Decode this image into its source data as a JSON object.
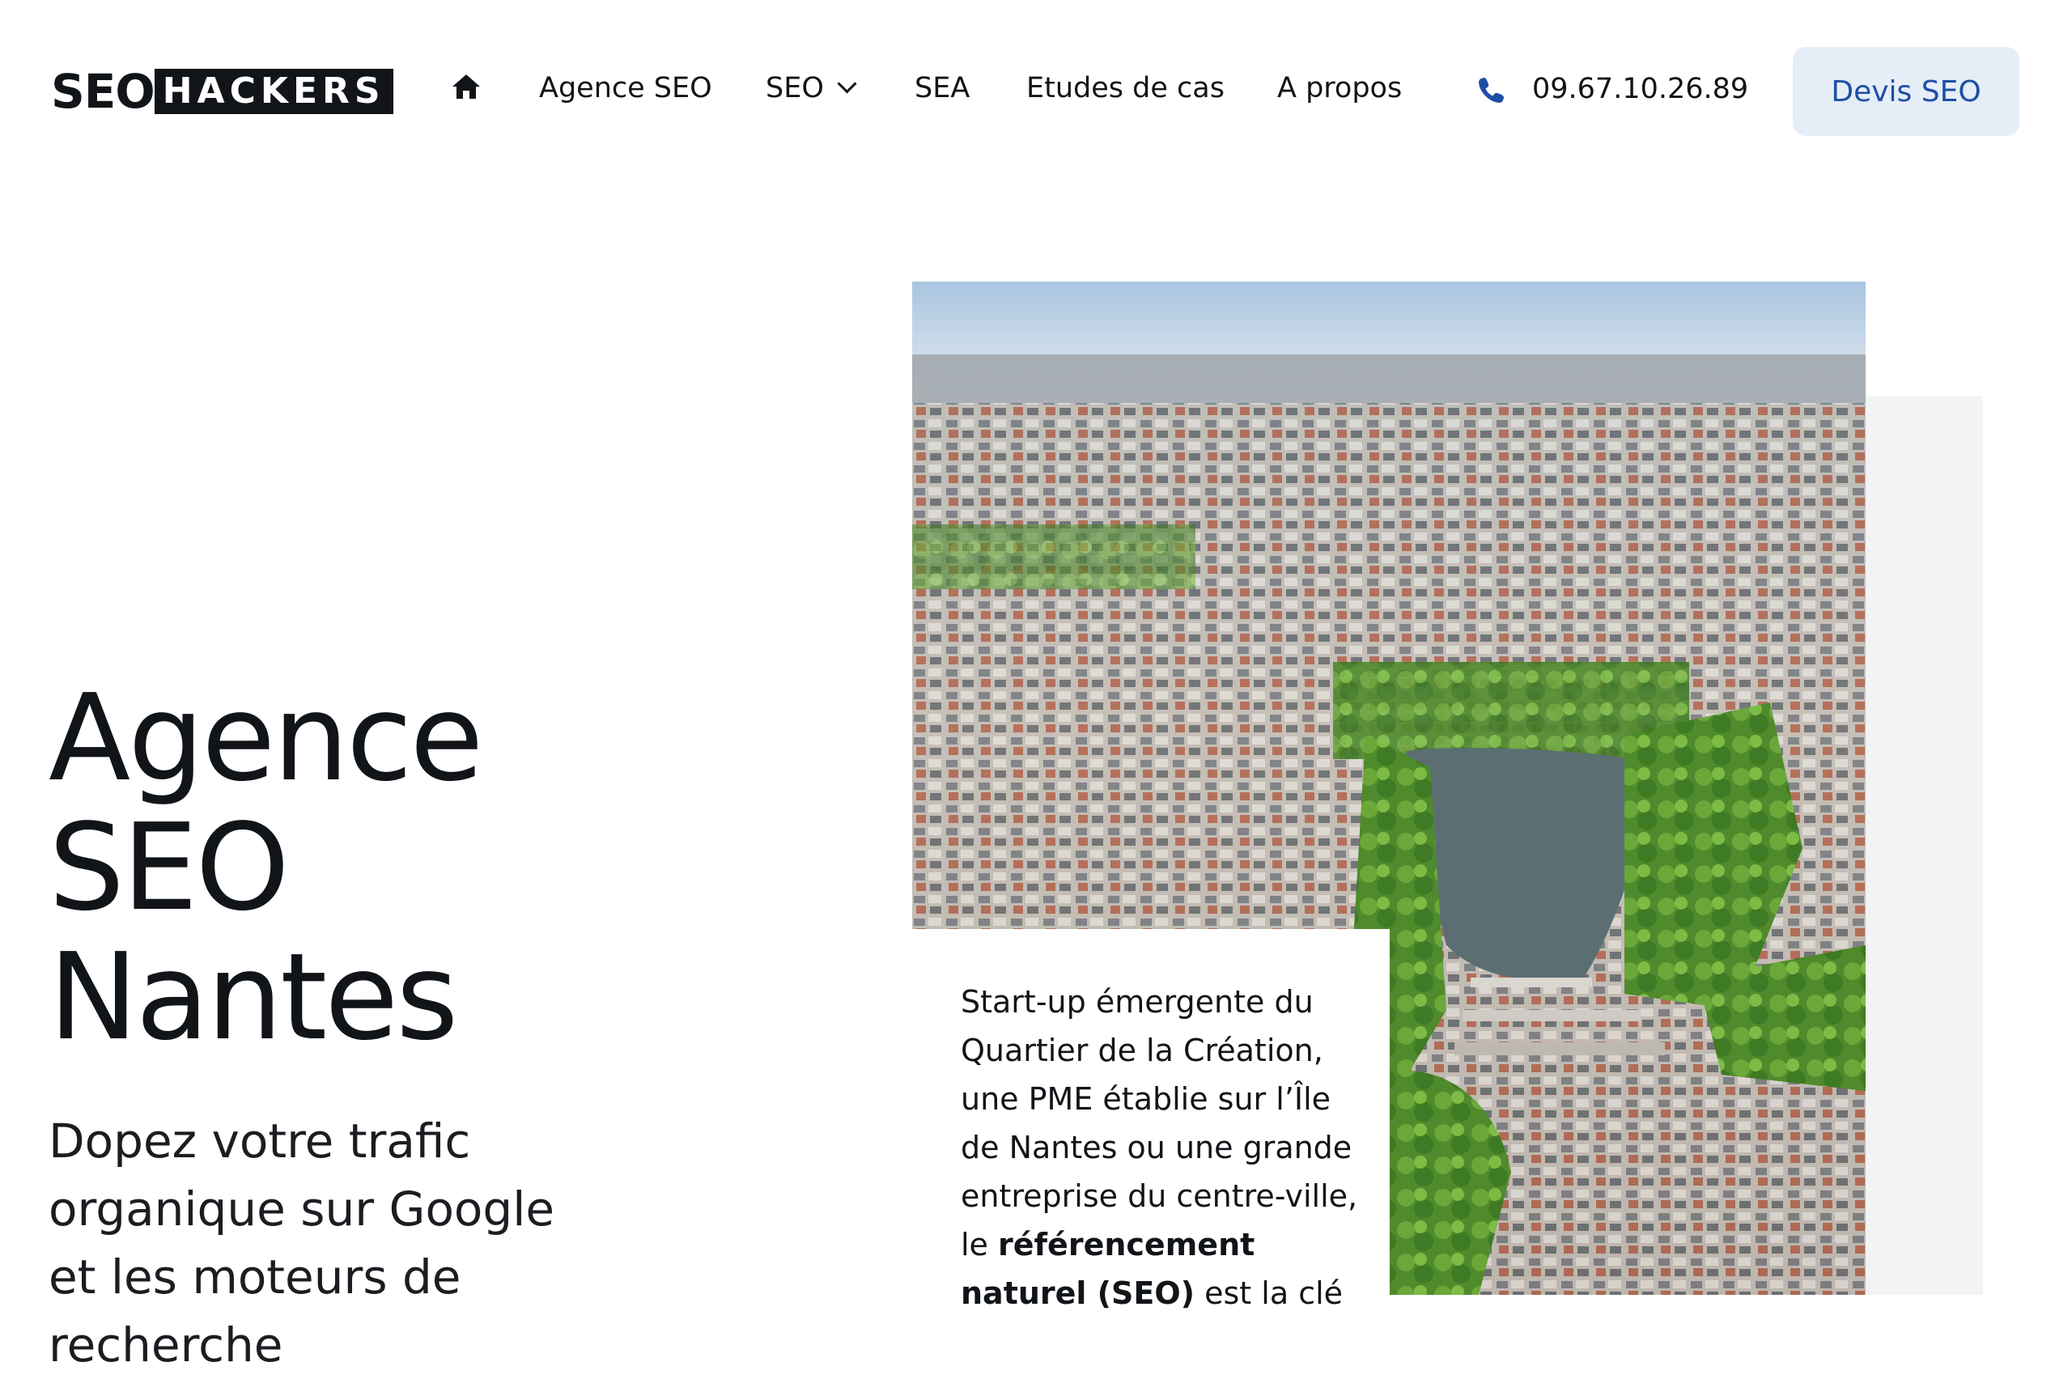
{
  "header": {
    "logo": {
      "left": "SEO",
      "right": "HACKERS"
    },
    "nav": [
      {
        "label": "Agence SEO"
      },
      {
        "label": "SEO"
      },
      {
        "label": "SEA"
      },
      {
        "label": "Etudes de cas"
      },
      {
        "label": "A propos"
      }
    ],
    "phone": "09.67.10.26.89",
    "cta": "Devis SEO"
  },
  "hero": {
    "title_lines": [
      "Agence",
      "SEO",
      "Nantes"
    ],
    "subtitle": "Dopez votre trafic organique sur Google et les moteurs de recherche"
  },
  "card": {
    "text_before": "Start-up émergente du Quartier de la Création, une PME établie sur l’Île de Nantes ou une grande entreprise du centre-ville, le ",
    "text_bold": "référencement naturel (SEO)",
    "text_after": " est la clé"
  },
  "colors": {
    "accent": "#1f4fa5",
    "cta_bg": "#e5edf7"
  },
  "icons": {
    "home": "home-icon",
    "phone": "phone-icon",
    "dropdown": "chevron-down-icon"
  }
}
